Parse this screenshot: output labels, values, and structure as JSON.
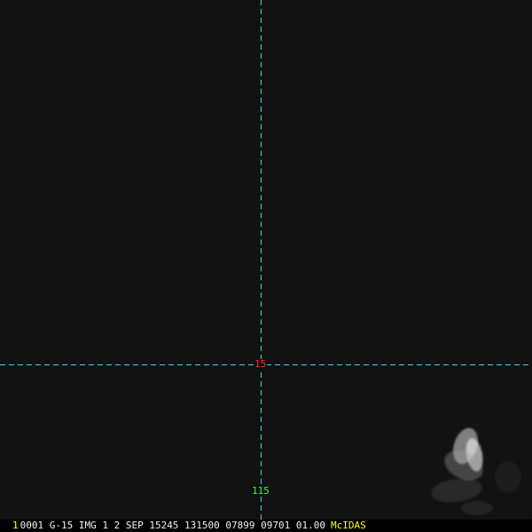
{
  "app": {
    "name": "McIDAS"
  },
  "display": {
    "frame_number": "1",
    "status_text": "0001 G-15 IMG     1  2 SEP 15245 131500 07899 09701 01.00"
  },
  "crosshair": {
    "lat_label": "15",
    "lon_label": "115",
    "line_color": "#40d0d8",
    "lat_color": "#ff2b2b",
    "lon_color": "#33ff33"
  },
  "colors": {
    "background": "#111111",
    "status_yellow": "#ffff00",
    "status_white": "#f2f2f2"
  }
}
